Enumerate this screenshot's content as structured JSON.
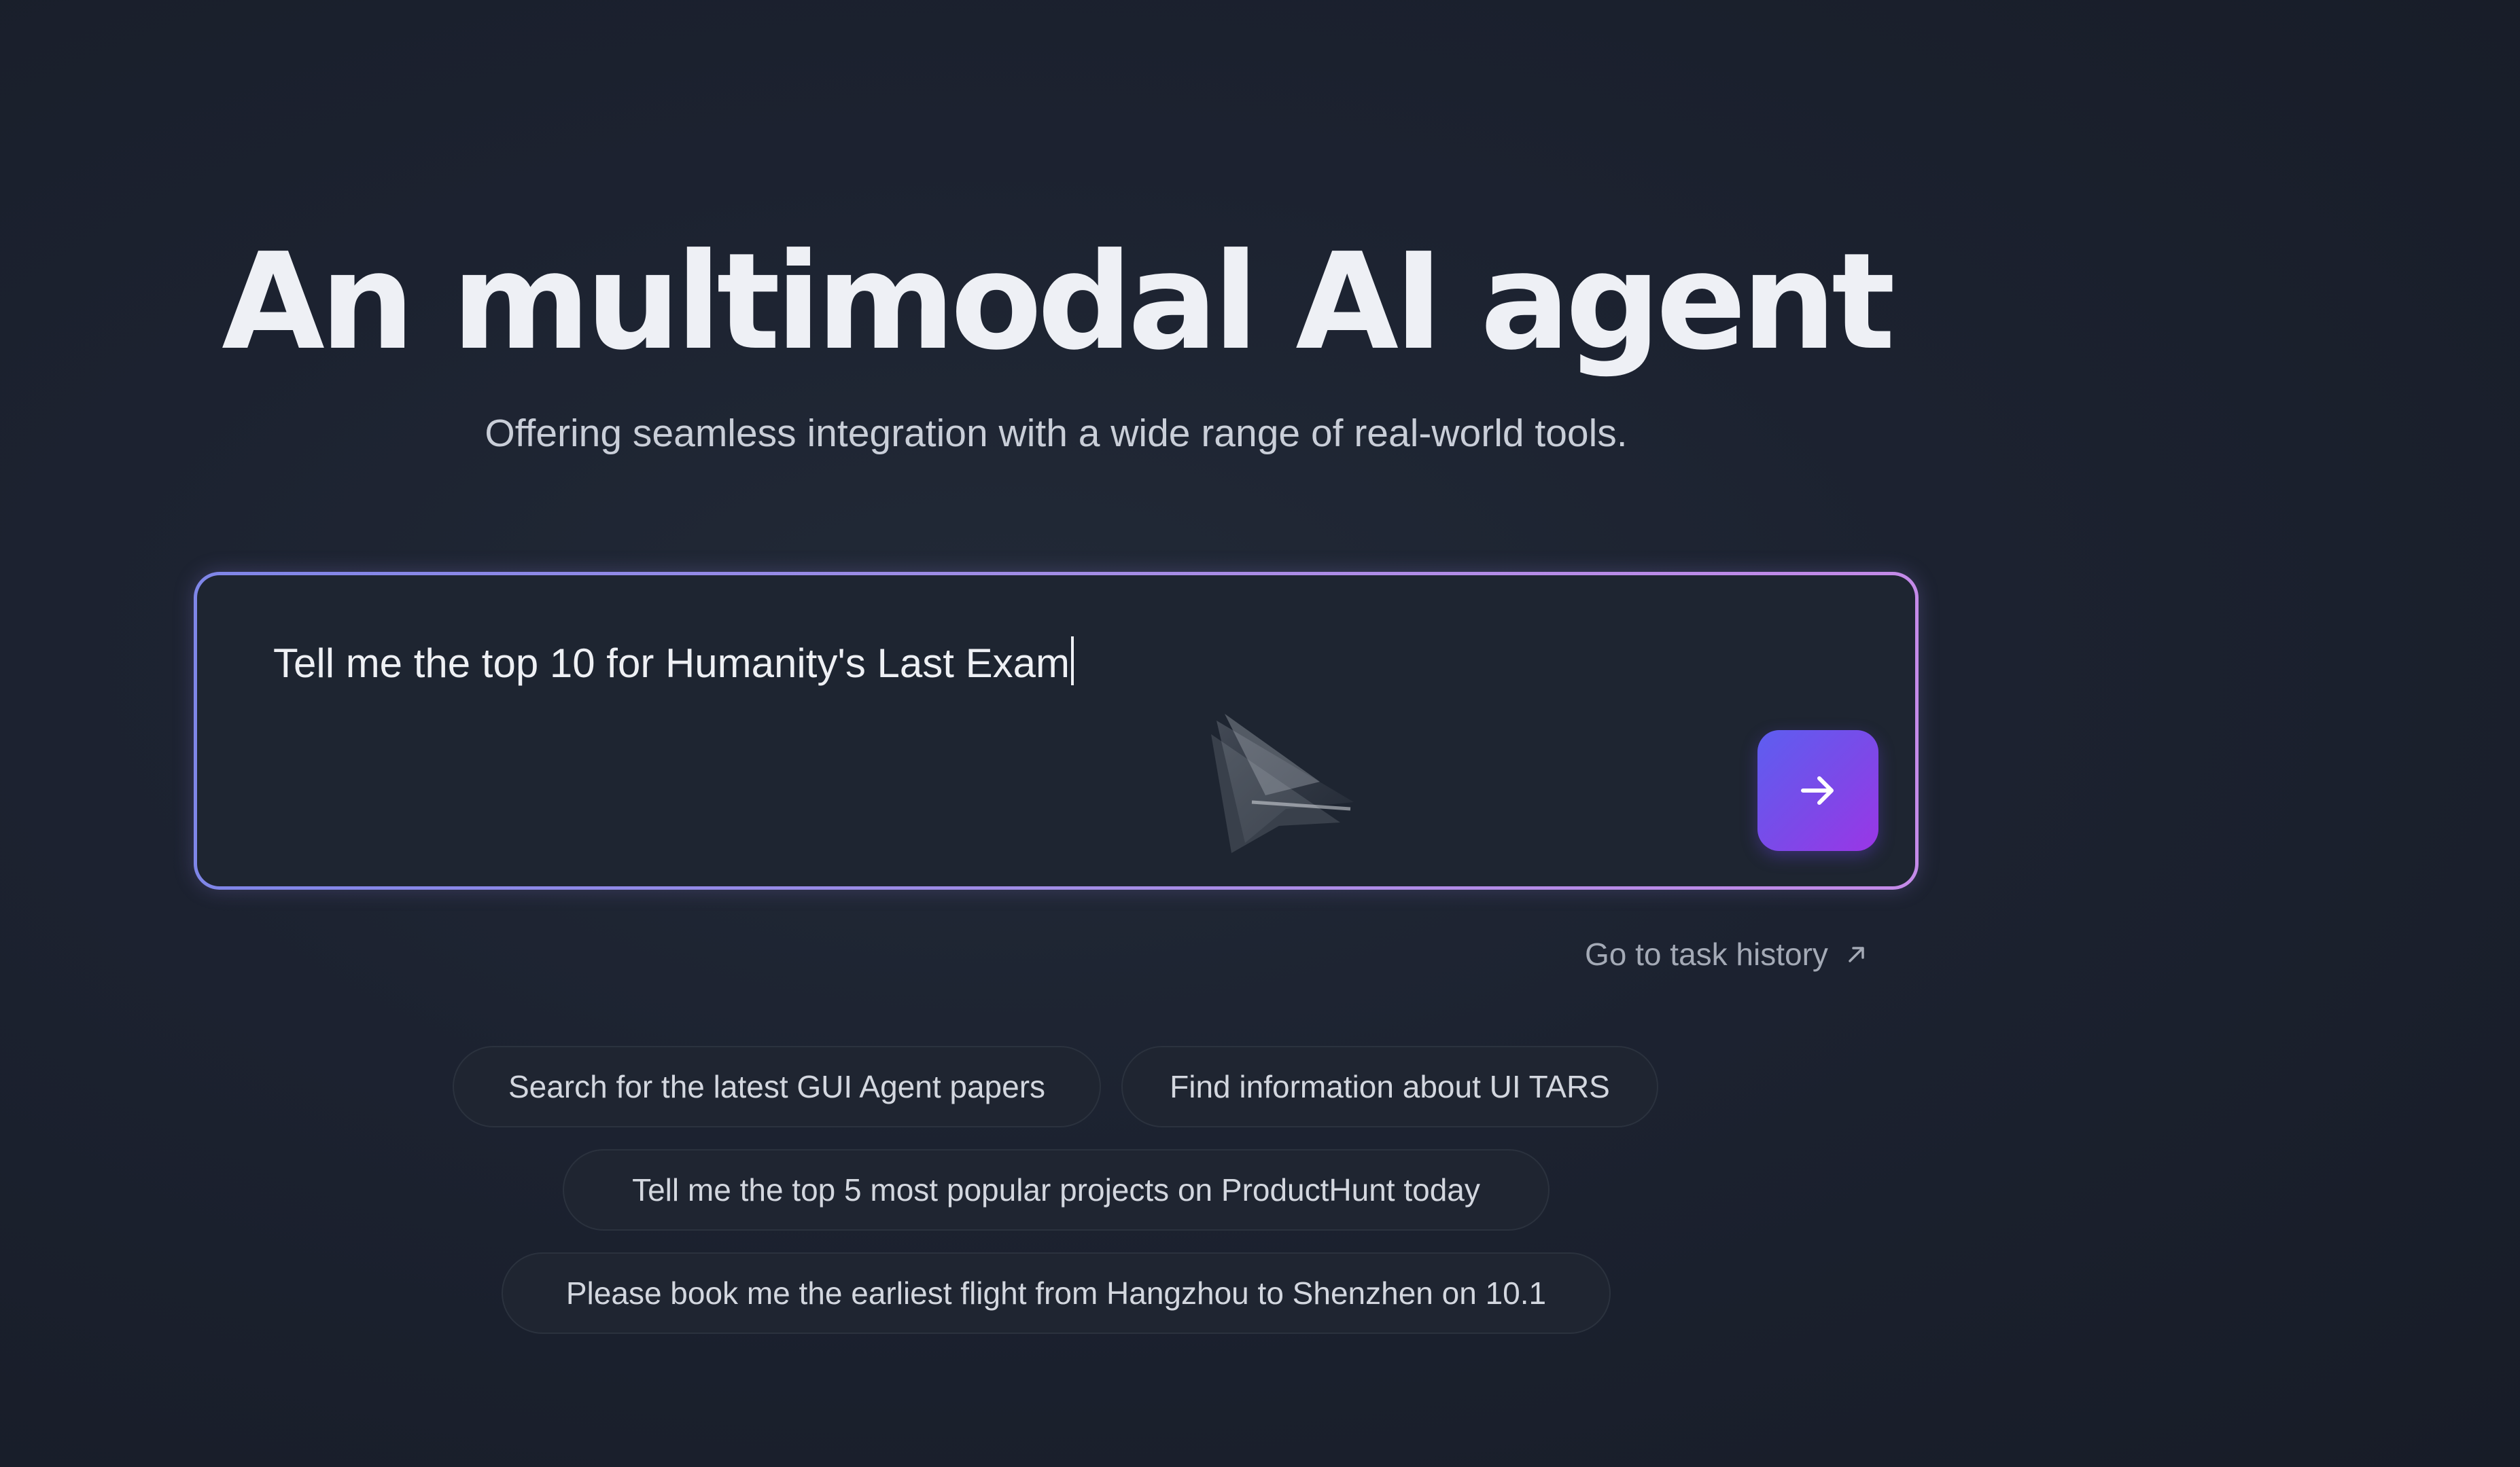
{
  "hero": {
    "title": "An multimodal AI agent",
    "subtitle": "Offering seamless integration with a wide range of real-world tools."
  },
  "prompt": {
    "value": "Tell me the top 10 for Humanity's Last Exam",
    "send_icon": "arrow-right-icon"
  },
  "history_link": {
    "label": "Go to task history",
    "icon": "arrow-up-right-icon"
  },
  "suggestions": [
    "Search for the latest GUI Agent papers",
    "Find information about UI TARS",
    "Tell me the top 5 most popular projects on ProductHunt today",
    "Please book me the earliest flight from Hangzhou to Shenzhen on 10.1"
  ],
  "colors": {
    "background": "#1a1f2b",
    "accent_start": "#5d5ef0",
    "accent_end": "#9a36e6",
    "border_gradient_start": "#7f86e8",
    "border_gradient_end": "#c48ae8"
  }
}
